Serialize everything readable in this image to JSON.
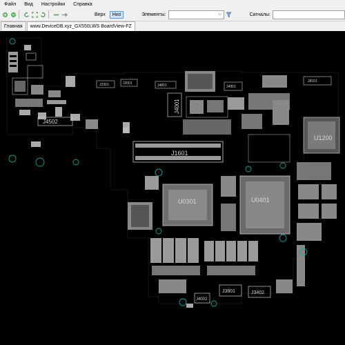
{
  "menu": {
    "file": "Файл",
    "view": "Вид",
    "settings": "Настройки",
    "help": "Справка"
  },
  "toolbar": {
    "top_label": "Верх",
    "bottom_label": "Низ",
    "elements_label": "Элементы:",
    "elements_value": "",
    "signals_label": "Сигналы:",
    "signals_value": ""
  },
  "tabs": [
    {
      "label": "Главная"
    },
    {
      "label": "www.DeviceDB.xyz_GX550LWS BoardView-FZ"
    }
  ],
  "board": {
    "background": "#000000",
    "trace_color": "#d8d8d8",
    "pad_color": "#9a9a9a",
    "via_color": "#1aa39a",
    "components": {
      "j4502": "J4502",
      "j1601": "J1601",
      "j4001": "J4001",
      "u0301": "U0301",
      "u0401": "U0401",
      "u1200": "U1200",
      "j3801": "J3801",
      "j3402": "J3402",
      "j4002": "J4002",
      "j2301": "J2301",
      "j2001": "J2001",
      "j4801": "J4801",
      "j4901": "J4901",
      "j8101": "J8101"
    }
  }
}
